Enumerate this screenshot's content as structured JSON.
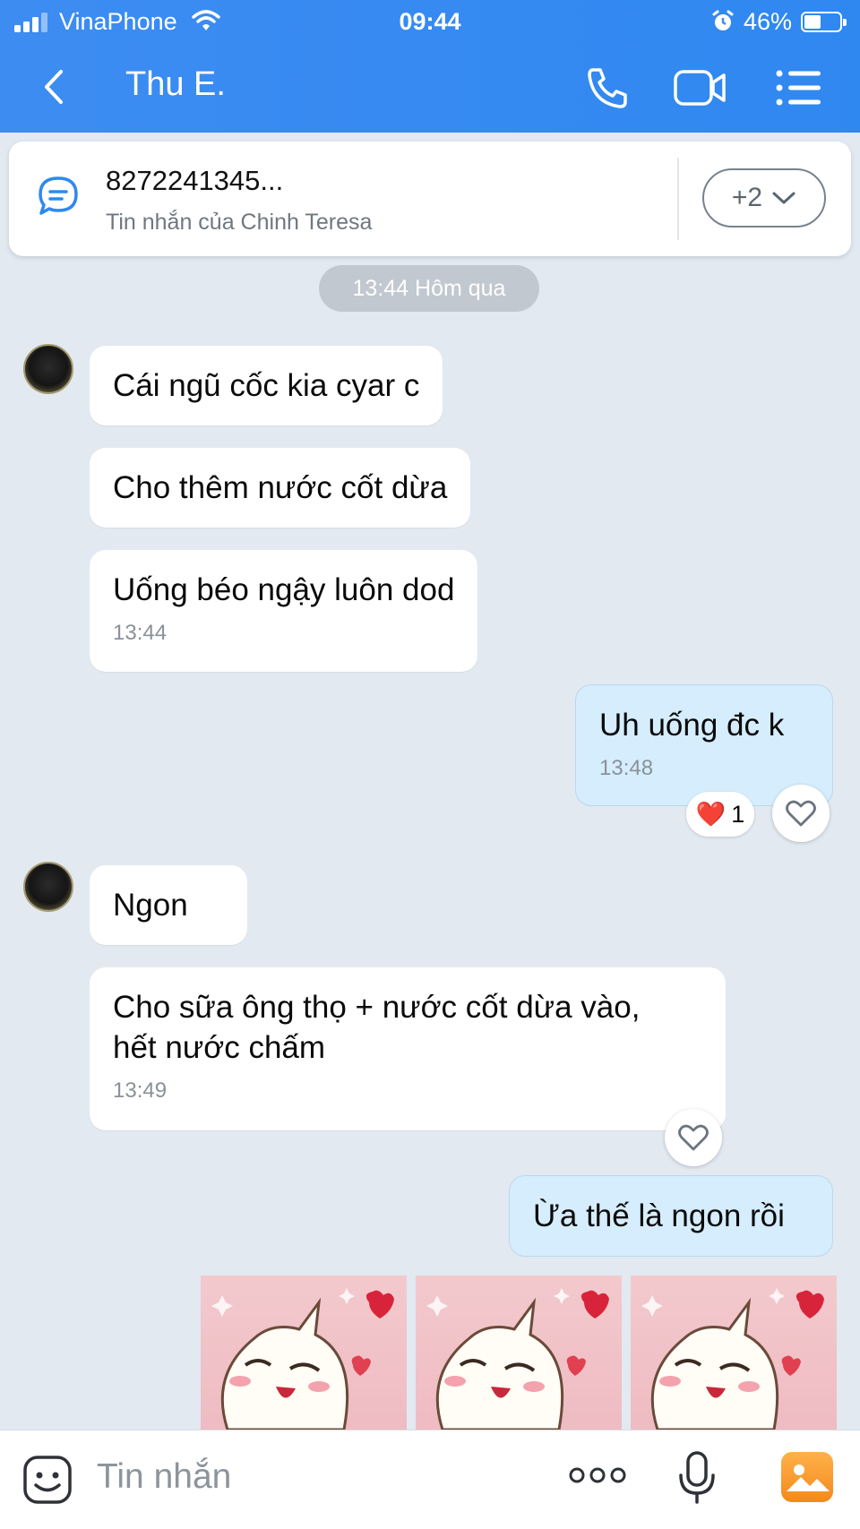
{
  "status_bar": {
    "carrier": "VinaPhone",
    "time": "09:44",
    "battery": "46%"
  },
  "header": {
    "contact_name": "Thu E."
  },
  "pinned": {
    "title": "8272241345...",
    "subtitle": "Tin nhắn của Chinh Teresa",
    "more_label": "+2"
  },
  "date_chip": "13:44 Hôm qua",
  "messages": [
    {
      "dir": "in",
      "text": "Cái ngũ cốc kia cyar c"
    },
    {
      "dir": "in",
      "text": "Cho thêm nước cốt dừa"
    },
    {
      "dir": "in",
      "text": "Uống béo ngậy luôn dod",
      "time": "13:44"
    },
    {
      "dir": "out",
      "text": "Uh uống đc k",
      "time": "13:48",
      "reaction": "❤️",
      "reaction_count": "1"
    },
    {
      "dir": "in",
      "text": "Ngon"
    },
    {
      "dir": "in",
      "text": "Cho sữa ông thọ + nước cốt dừa vào,",
      "text2": "hết nước chấm",
      "time": "13:49"
    },
    {
      "dir": "out",
      "text": "Ừa thế là ngon rồi"
    }
  ],
  "stickers_count": 3,
  "input": {
    "placeholder": "Tin nhắn"
  },
  "colors": {
    "header": "#3d8cf2",
    "bubble_out": "#d5edfc",
    "bubble_in": "#ffffff",
    "background": "#e2e9f1"
  }
}
